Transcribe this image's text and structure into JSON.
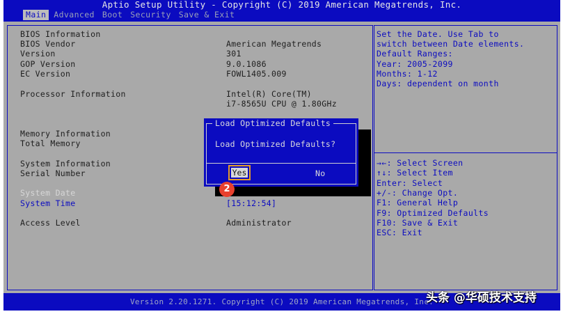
{
  "header": {
    "title": "Aptio Setup Utility - Copyright (C) 2019 American Megatrends, Inc.",
    "tabs": [
      "Main",
      "Advanced",
      "Boot",
      "Security",
      "Save & Exit"
    ]
  },
  "main": {
    "bios_info_label": "BIOS Information",
    "bios_vendor_label": "BIOS Vendor",
    "bios_vendor_value": "American Megatrends",
    "version_label": "Version",
    "version_value": "301",
    "gop_label": "GOP Version",
    "gop_value": "9.0.1086",
    "ec_label": "EC Version",
    "ec_value": "FOWL1405.009",
    "processor_label": "Processor Information",
    "processor_value_1": "Intel(R) Core(TM)",
    "processor_value_2": "i7-8565U CPU @ 1.80GHz",
    "memory_info_label": "Memory Information",
    "total_memory_label": "Total Memory",
    "system_info_label": "System Information",
    "serial_label": "Serial Number",
    "system_date_label": "System Date",
    "system_time_label": "System Time",
    "system_time_value": "[15:12:54]",
    "access_label": "Access Level",
    "access_value": "Administrator"
  },
  "help": {
    "description": [
      "Set the Date. Use Tab to",
      "switch between Date elements.",
      "Default Ranges:",
      "Year: 2005-2099",
      "Months: 1-12",
      "Days: dependent on month"
    ],
    "keys": [
      "→←: Select Screen",
      "↑↓: Select Item",
      "Enter: Select",
      "+/-: Change Opt.",
      "F1: General Help",
      "F9: Optimized Defaults",
      "F10: Save & Exit",
      "ESC: Exit"
    ]
  },
  "dialog": {
    "title": "Load Optimized Defaults",
    "message": "Load Optimized Defaults?",
    "yes_label": "Yes",
    "no_label": "No"
  },
  "annotation": {
    "step_badge": "2"
  },
  "footer": {
    "text": "Version 2.20.1271. Copyright (C) 2019 American Megatrends, Inc."
  },
  "watermark": "头条 @华硕技术支持"
}
